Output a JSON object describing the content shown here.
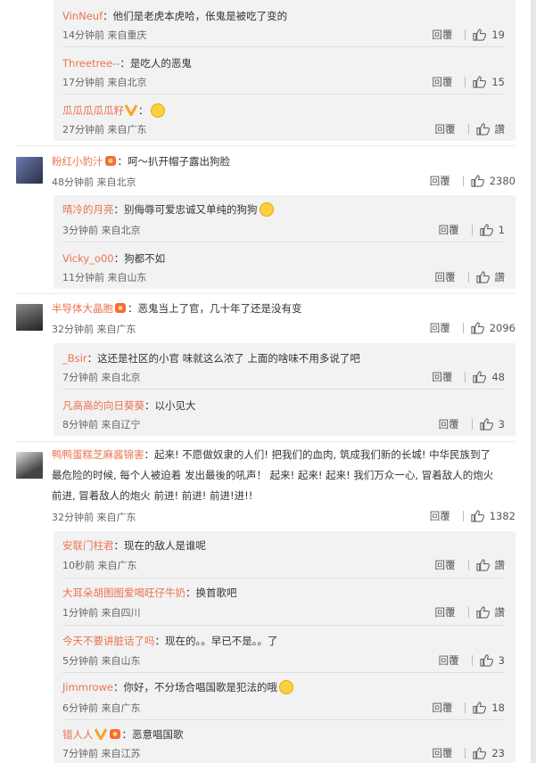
{
  "reply_label": "回覆",
  "like_label": "讚",
  "threads": [
    {
      "main": null,
      "replies": [
        {
          "user": "VinNeuf",
          "text": "他们是老虎本虎哈，伥鬼是被吃了变的",
          "time": "14分钟前",
          "loc": "来自重庆",
          "likes": "19"
        },
        {
          "user": "Threetree--",
          "text": "是吃人的恶鬼",
          "time": "17分钟前",
          "loc": "来自北京",
          "likes": "15"
        },
        {
          "user": "瓜瓜瓜瓜瓜籽",
          "text": "",
          "time": "27分钟前",
          "loc": "来自广东",
          "likes": "讚"
        }
      ]
    },
    {
      "main": {
        "user": "粉红小豹汁",
        "text": "呵～扒开帽子露出狗脸",
        "time": "48分钟前",
        "loc": "来自北京",
        "likes": "2380"
      },
      "replies": [
        {
          "user": "晴冷的月亮",
          "text": "别侮辱可爱忠诚又单纯的狗狗",
          "time": "3分钟前",
          "loc": "来自北京",
          "likes": "1"
        },
        {
          "user": "Vicky_o00",
          "text": "狗都不如",
          "time": "11分钟前",
          "loc": "来自山东",
          "likes": "讚"
        }
      ]
    },
    {
      "main": {
        "user": "半导体大晶胞",
        "text": "恶鬼当上了官，几十年了还是没有变",
        "time": "32分钟前",
        "loc": "来自广东",
        "likes": "2096"
      },
      "replies": [
        {
          "user": "_Bsir",
          "text": "这还是社区的小官 味就这么浓了 上面的啥味不用多说了吧",
          "time": "7分钟前",
          "loc": "来自北京",
          "likes": "48"
        },
        {
          "user": "凡高高的向日葵葵",
          "text": "以小见大",
          "time": "8分钟前",
          "loc": "来自辽宁",
          "likes": "3"
        }
      ]
    },
    {
      "main": {
        "user": "鸭鸭蛋糕芝麻酱锦害",
        "text1": "起来! 不愿做奴隶的人们! 把我们的血肉, 筑成我们新的长城! 中华民族到了",
        "text2": "最危险的时候, 每个人被迫着 发出最後的吼声！ 起来! 起来! 起来! 我们万众一心, 冒着敌人的炮火",
        "text3": "前进, 冒着敌人的炮火 前进! 前进! 前进!进!!",
        "time": "32分钟前",
        "loc": "来自广东",
        "likes": "1382"
      },
      "replies": [
        {
          "user": "安联门柱君",
          "text": "现在的敌人是谁呢",
          "time": "10秒前",
          "loc": "来自广东",
          "likes": "讚"
        },
        {
          "user": "大耳朵胡图图爱喝旺仔牛奶",
          "text": "换首歌吧",
          "time": "1分钟前",
          "loc": "来自四川",
          "likes": "讚"
        },
        {
          "user": "今天不要讲脏话了吗",
          "text": "现在的。。早已不是。。了",
          "time": "5分钟前",
          "loc": "来自山东",
          "likes": "3"
        },
        {
          "user": "Jimmrowe",
          "text": "你好，不分场合唱国歌是犯法的哦",
          "time": "6分钟前",
          "loc": "来自广东",
          "likes": "18"
        },
        {
          "user": "错人人",
          "text": "恶意唱国歌",
          "time": "7分钟前",
          "loc": "来自江苏",
          "likes": "23"
        }
      ]
    }
  ],
  "colors": {
    "username": "#eb7350",
    "reply_bg": "#f2f2f2"
  }
}
